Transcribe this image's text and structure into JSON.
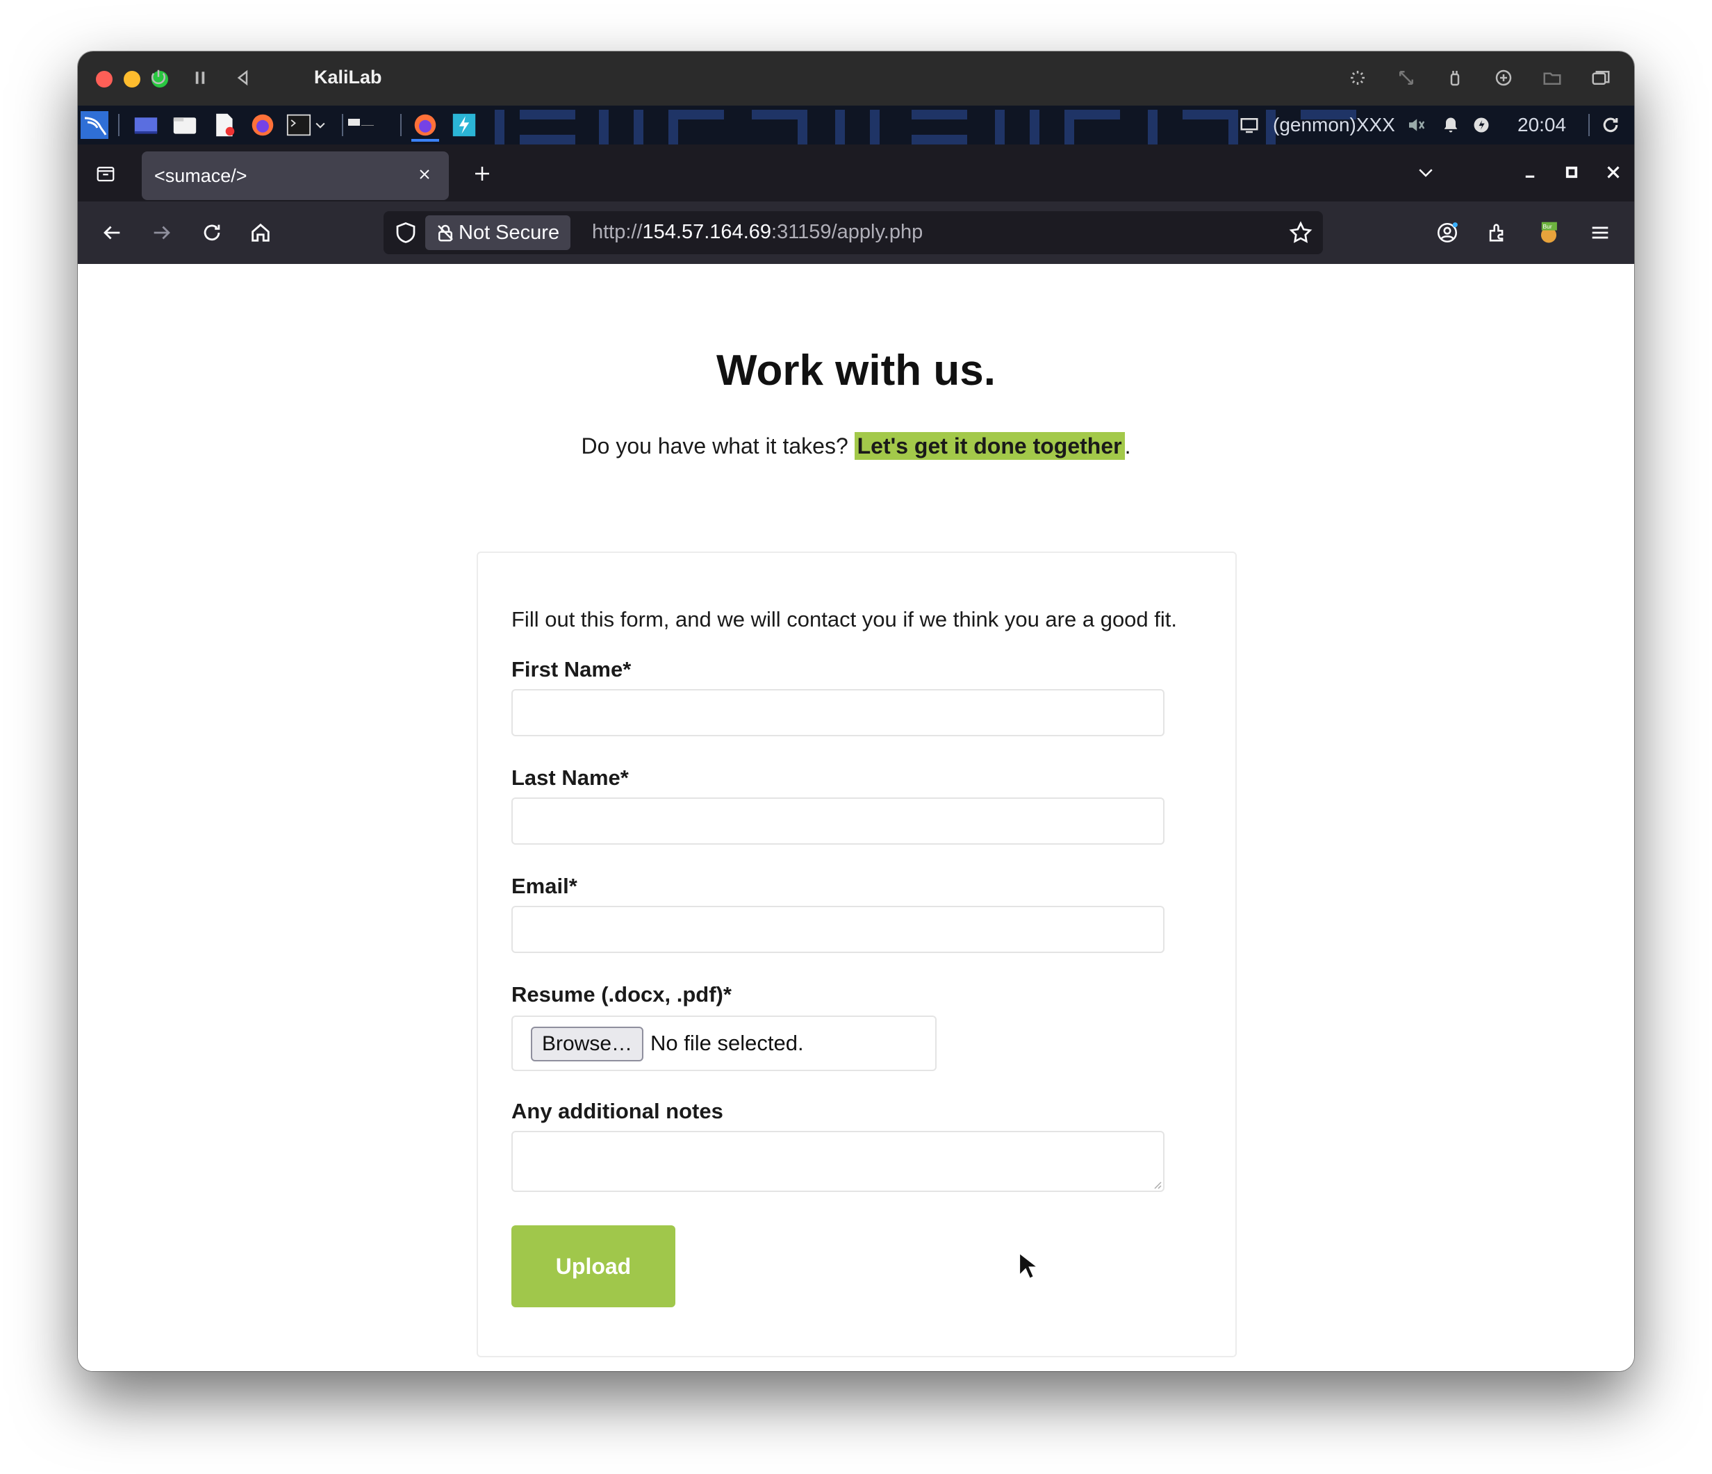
{
  "vm": {
    "title": "KaliLab"
  },
  "panel": {
    "genmon": "(genmon)XXX",
    "clock": "20:04"
  },
  "browser": {
    "tab_title": "<sumace/>",
    "security_label": "Not Secure",
    "url_scheme": "http://",
    "url_host": "154.57.164.69",
    "url_rest": ":31159/apply.php",
    "burp_badge": "Bur"
  },
  "page": {
    "title": "Work with us.",
    "subtitle_prefix": "Do you have what it takes? ",
    "subtitle_highlight": "Let's get it done together",
    "subtitle_suffix": ".",
    "intro": "Fill out this form, and we will contact you if we think you are a good fit.",
    "fields": {
      "first_name_label": "First Name*",
      "first_name_value": "",
      "last_name_label": "Last Name*",
      "last_name_value": "",
      "email_label": "Email*",
      "email_value": "",
      "resume_label": "Resume (.docx, .pdf)*",
      "browse_label": "Browse…",
      "file_status": "No file selected.",
      "notes_label": "Any additional notes",
      "notes_value": ""
    },
    "upload_label": "Upload"
  },
  "colors": {
    "accent": "#a0c74b",
    "highlight": "#a3c94a"
  }
}
